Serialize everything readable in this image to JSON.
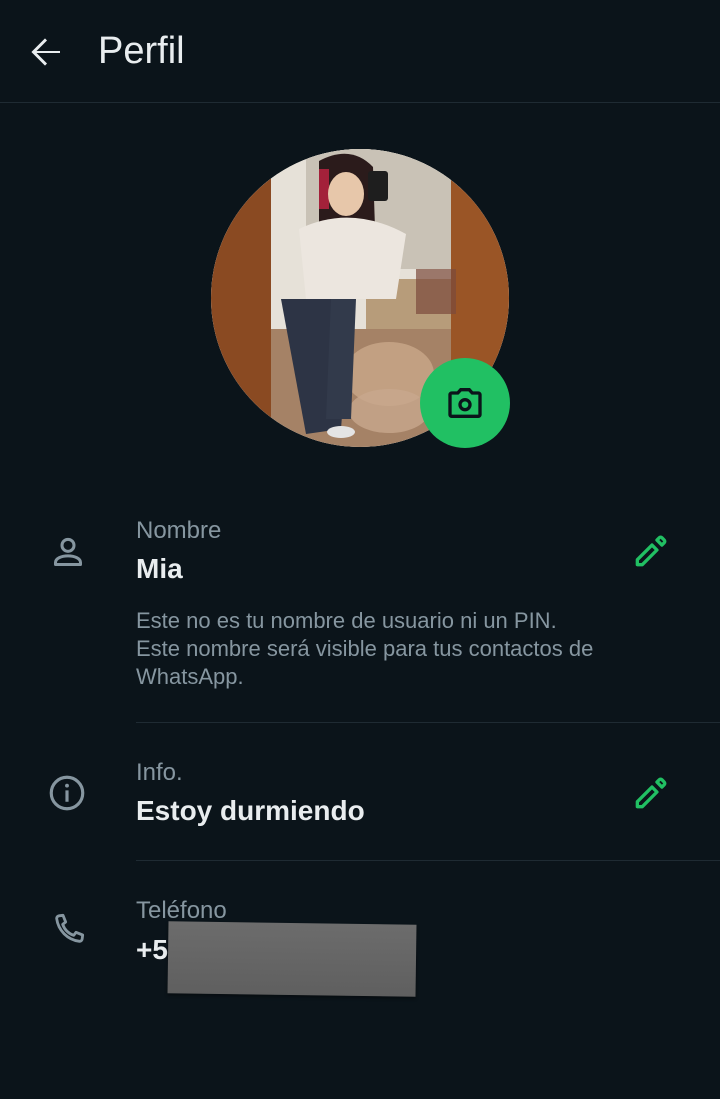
{
  "header": {
    "title": "Perfil"
  },
  "name": {
    "label": "Nombre",
    "value": "Mia",
    "hint_line1": "Este no es tu nombre de usuario ni un PIN.",
    "hint_line2": "Este nombre será visible para tus contactos de WhatsApp."
  },
  "about": {
    "label": "Info.",
    "value": "Estoy durmiendo"
  },
  "phone": {
    "label": "Teléfono",
    "value_visible": "+5"
  },
  "colors": {
    "background": "#0b141a",
    "accent": "#21c063",
    "secondary_text": "#8696a0",
    "primary_text": "#e9edef"
  },
  "icons": [
    "back-arrow-icon",
    "camera-icon",
    "person-icon",
    "pencil-icon",
    "info-icon",
    "phone-icon"
  ]
}
